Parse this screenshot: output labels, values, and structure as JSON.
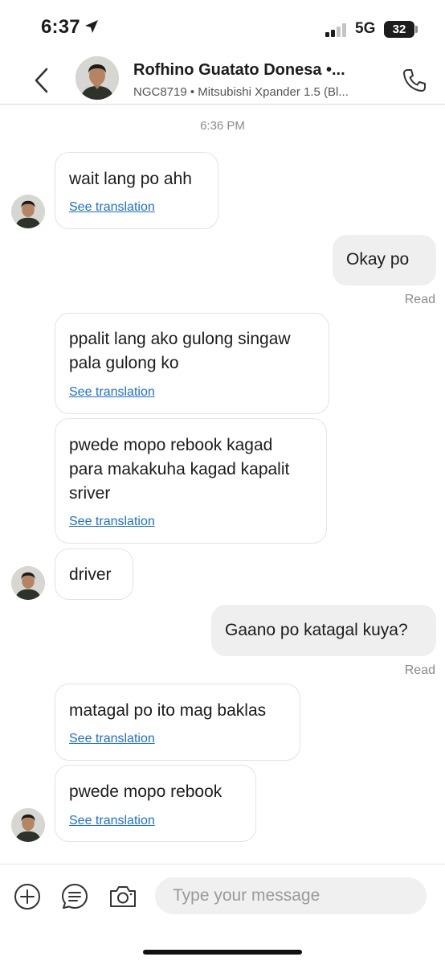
{
  "status_bar": {
    "time": "6:37",
    "network": "5G",
    "battery": "32"
  },
  "header": {
    "contact_name": "Rofhino Guatato Donesa •...",
    "contact_subtitle": "NGC8719 • Mitsubishi Xpander 1.5 (Bl..."
  },
  "chat": {
    "timestamp": "6:36 PM",
    "messages": [
      {
        "direction": "incoming",
        "lines": [
          "wait lang po ahh"
        ],
        "translation_link": "See translation"
      },
      {
        "direction": "outgoing",
        "lines": [
          "Okay po"
        ],
        "status": "Read"
      },
      {
        "direction": "incoming",
        "lines": [
          "ppalit lang ako gulong singaw",
          "pala gulong ko"
        ],
        "translation_link": "See translation"
      },
      {
        "direction": "incoming",
        "lines": [
          "pwede mopo rebook kagad",
          "para makakuha kagad kapalit",
          "sriver"
        ],
        "translation_link": "See translation"
      },
      {
        "direction": "incoming",
        "lines": [
          "driver"
        ]
      },
      {
        "direction": "outgoing",
        "lines": [
          "Gaano po katagal kuya?"
        ],
        "status": "Read"
      },
      {
        "direction": "incoming",
        "lines": [
          "matagal po ito mag baklas"
        ],
        "translation_link": "See translation"
      },
      {
        "direction": "incoming",
        "lines": [
          "pwede mopo rebook"
        ],
        "translation_link": "See translation"
      }
    ]
  },
  "composer": {
    "placeholder": "Type your message",
    "icons": [
      "add-icon",
      "quick-reply-icon",
      "camera-icon"
    ]
  },
  "colors": {
    "link": "#1b6fd0",
    "outgoing_bubble": "#efefef",
    "incoming_border": "#e3e3e3",
    "muted_text": "#8a8a8a"
  }
}
